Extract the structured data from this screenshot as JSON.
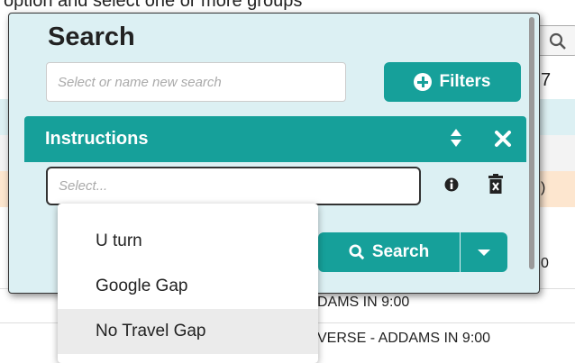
{
  "background": {
    "top_text": "option and select one or more groups",
    "side_digit_1": "7",
    "side_digit_2": ")",
    "side_digit_3": "0",
    "row_text_1": "DAMS IN 9:00",
    "row_text_2": "VERSE - ADDAMS IN 9:00"
  },
  "modal": {
    "title": "Search",
    "search_name_placeholder": "Select or name new search",
    "filters_label": "Filters",
    "instructions": {
      "title": "Instructions",
      "select_placeholder": "Select..."
    },
    "search_label": "Search"
  },
  "dropdown": {
    "options": [
      "U turn",
      "Google Gap",
      "No Travel Gap"
    ],
    "highlighted": "No Travel Gap"
  },
  "colors": {
    "accent": "#16a09a",
    "modal_bg": "#dcf0f3",
    "row_highlight_orange": "#fde6cf"
  }
}
